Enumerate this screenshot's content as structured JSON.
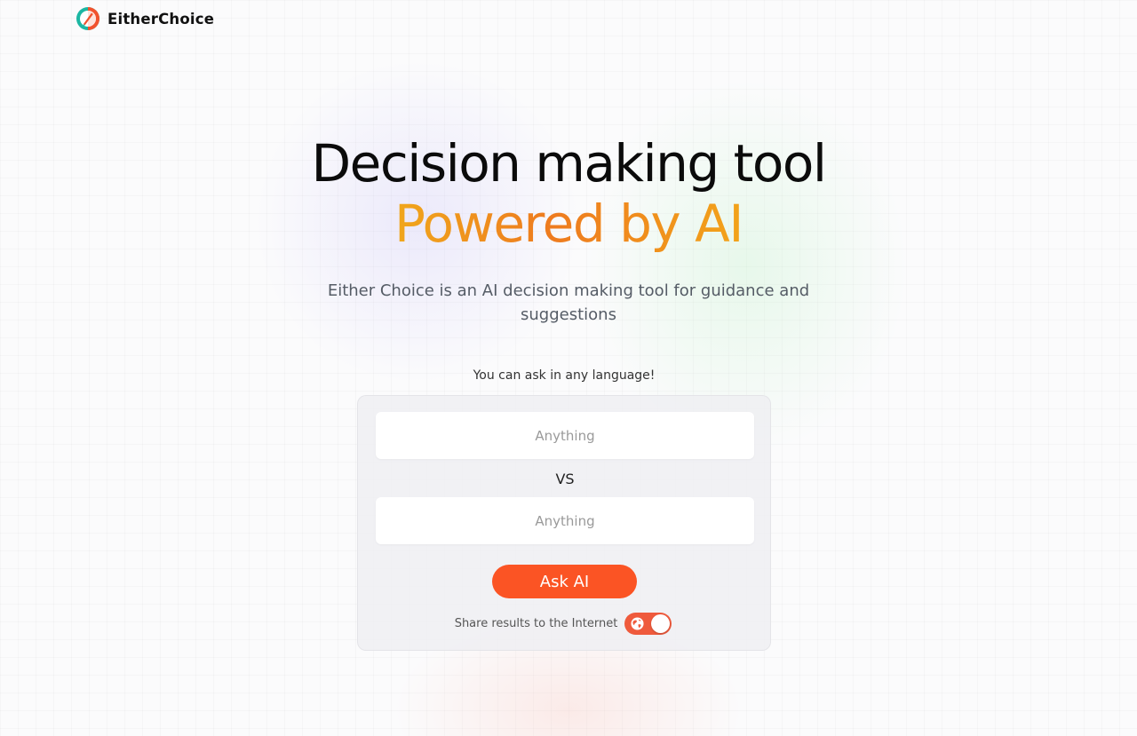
{
  "header": {
    "brand_name": "EitherChoice",
    "logo_icon": "eitherchoice-logo-icon"
  },
  "hero": {
    "title_line1": "Decision making tool",
    "title_line2": "Powered by AI",
    "subtitle": "Either Choice is an AI decision making tool for guidance and suggestions"
  },
  "form": {
    "language_hint": "You can ask in any language!",
    "option_a": {
      "value": "",
      "placeholder": "Anything"
    },
    "vs_label": "VS",
    "option_b": {
      "value": "",
      "placeholder": "Anything"
    },
    "submit_label": "Ask AI",
    "share_label": "Share results to the Internet",
    "share_enabled": true,
    "share_icon": "globe-icon"
  },
  "colors": {
    "accent": "#fb5424",
    "toggle_on": "#ef5a3c",
    "gradient_start": "#f0a71c",
    "gradient_mid": "#ee7b1f"
  }
}
